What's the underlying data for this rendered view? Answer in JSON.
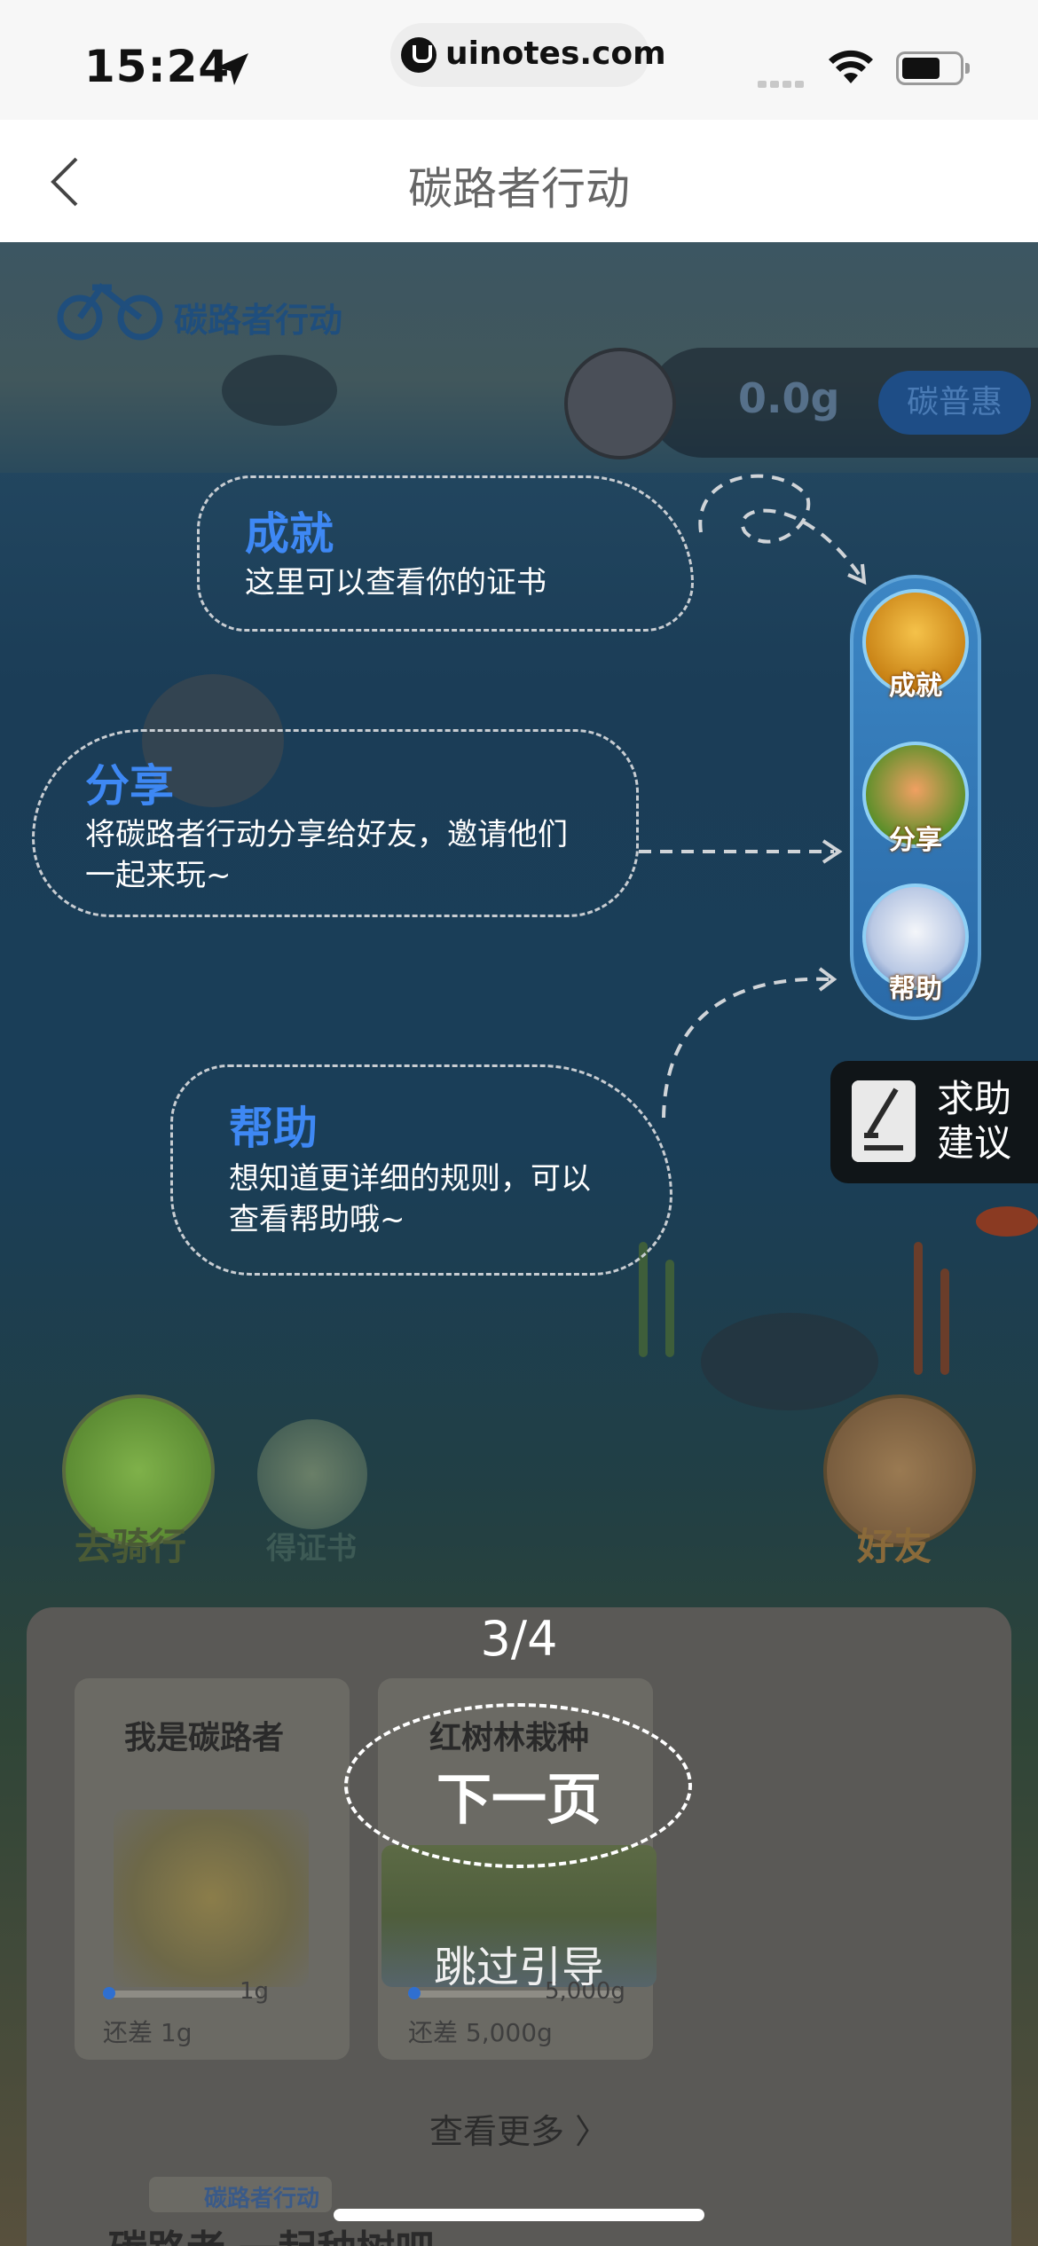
{
  "status_bar": {
    "time": "15:24",
    "url": "uinotes.com"
  },
  "nav": {
    "title": "碳路者行动"
  },
  "scene": {
    "brand": "碳路者行动",
    "score": "0.0g",
    "pu_button": "碳普惠"
  },
  "right_rail": {
    "items": [
      {
        "label": "成就",
        "icon": "trophy-icon"
      },
      {
        "label": "分享",
        "icon": "megaphone-icon"
      },
      {
        "label": "帮助",
        "icon": "book-icon"
      }
    ]
  },
  "help_tab": {
    "line1": "求助",
    "line2": "建议"
  },
  "bottom_buttons": {
    "ride": "去骑行",
    "cert": "得证书",
    "friends": "好友"
  },
  "guide": {
    "achievement": {
      "title": "成就",
      "desc": "这里可以查看你的证书"
    },
    "share": {
      "title": "分享",
      "desc_line1": "将碳路者行动分享给好友，邀请他们",
      "desc_line2": "一起来玩~"
    },
    "help": {
      "title": "帮助",
      "desc_line1": "想知道更详细的规则，可以",
      "desc_line2": "查看帮助哦~"
    },
    "page_indicator": "3/4",
    "next": "下一页",
    "skip": "跳过引导"
  },
  "panel": {
    "cards": [
      {
        "title": "我是碳路者",
        "target": "1g",
        "remaining": "还差 1g",
        "progress": 0.02
      },
      {
        "title": "红树林栽种",
        "target": "5,000g",
        "remaining": "还差 5,000g",
        "progress": 0.01
      }
    ],
    "more": "查看更多",
    "bottom_brand": "碳路者行动",
    "bottom_cut_text": "碳路者 一起种树吧"
  },
  "colors": {
    "accent_blue": "#3e88f4",
    "rail_blue": "#3c86c4"
  }
}
